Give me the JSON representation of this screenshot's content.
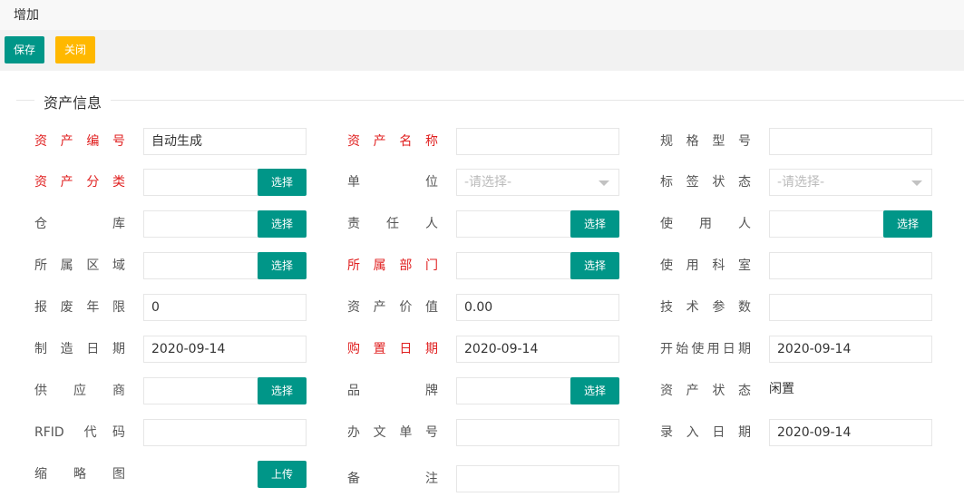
{
  "title": "增加",
  "toolbar": {
    "save": "保存",
    "close": "关闭"
  },
  "legend": "资产信息",
  "labels": {
    "asset_no": "资产编号",
    "asset_name": "资产名称",
    "spec": "规格型号",
    "category": "资产分类",
    "unit": "单位",
    "tag_status": "标签状态",
    "warehouse": "仓库",
    "owner": "责任人",
    "user": "使用人",
    "region": "所属区域",
    "dept": "所属部门",
    "section": "使用科室",
    "scrap_years": "报废年限",
    "value": "资产价值",
    "tech_params": "技术参数",
    "mfg_date": "制造日期",
    "purchase_date": "购置日期",
    "start_date": "开始使用日期",
    "supplier": "供应商",
    "brand": "品牌",
    "asset_status": "资产状态",
    "rfid": "RFID 代码",
    "doc_no": "办文单号",
    "entry_date": "录入日期",
    "thumb": "缩略图",
    "remark": "备注"
  },
  "values": {
    "asset_no": "自动生成",
    "scrap_years": "0",
    "value": "0.00",
    "mfg_date": "2020-09-14",
    "purchase_date": "2020-09-14",
    "start_date": "2020-09-14",
    "entry_date": "2020-09-14",
    "asset_status": "闲置"
  },
  "placeholders": {
    "unit": "-请选择-",
    "tag_status": "-请选择-"
  },
  "buttons": {
    "select": "选择",
    "upload": "上传"
  },
  "colors": {
    "primary": "#009688",
    "warning": "#ffb800",
    "required": "#e02020"
  }
}
